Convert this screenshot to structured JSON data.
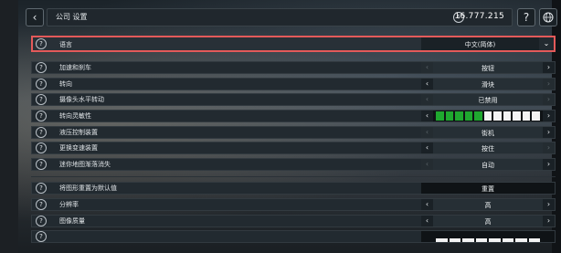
{
  "header": {
    "back_icon": "chevron-left-icon",
    "breadcrumb": "公司  设置",
    "currency_icon": "coin-icon",
    "money": "16.777.215",
    "help_icon": "question-icon",
    "globe_icon": "globe-icon"
  },
  "language": {
    "label": "语言",
    "value": "中文(简体)"
  },
  "settings": [
    {
      "label": "加速和刹车",
      "value": "按钮",
      "left_enabled": false,
      "right_enabled": true
    },
    {
      "label": "转向",
      "value": "滑块",
      "left_enabled": true,
      "right_enabled": false
    },
    {
      "label": "摄像头水平转动",
      "value": "已禁用",
      "left_enabled": false,
      "right_enabled": false
    },
    {
      "label": "转向灵敏性",
      "value": "",
      "slider_green": 5,
      "slider_white": 6,
      "left_enabled": true,
      "right_enabled": true
    },
    {
      "label": "液压控制装置",
      "value": "街机",
      "left_enabled": false,
      "right_enabled": true
    },
    {
      "label": "更换变速装置",
      "value": "按住",
      "left_enabled": true,
      "right_enabled": false
    },
    {
      "label": "迷你地图渐落消失",
      "value": "自动",
      "left_enabled": false,
      "right_enabled": true
    }
  ],
  "reset": {
    "label": "将图形重置为默认值",
    "button": "重置"
  },
  "graphics": [
    {
      "label": "分辨率",
      "value": "高",
      "left_enabled": true,
      "right_enabled": true
    },
    {
      "label": "图像质量",
      "value": "高",
      "left_enabled": true,
      "right_enabled": true
    }
  ],
  "help_mark": "?"
}
